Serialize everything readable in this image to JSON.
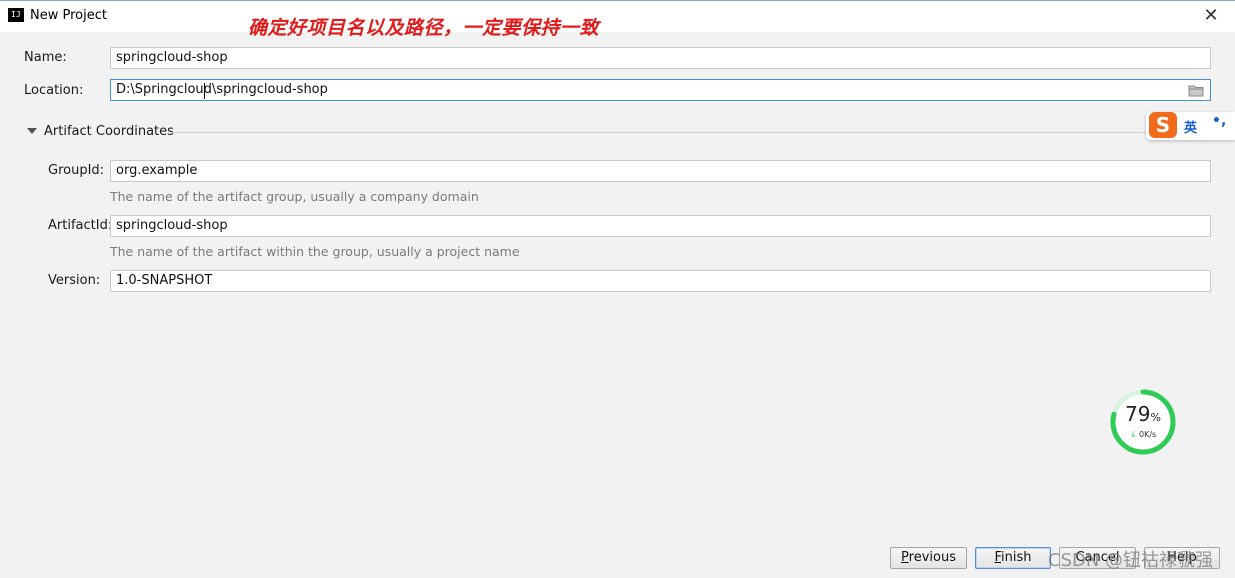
{
  "window": {
    "title": "New Project",
    "app_icon_text": "IJ",
    "close_glyph": "✕"
  },
  "annotation": "确定好项目名以及路径，一定要保持一致",
  "form": {
    "name_label": "Name:",
    "name_value": "springcloud-shop",
    "location_label": "Location:",
    "location_value": "D:\\Springcloud\\springcloud-shop"
  },
  "artifact": {
    "section_title": "Artifact Coordinates",
    "groupid_label": "GroupId:",
    "groupid_value": "org.example",
    "groupid_hint": "The name of the artifact group, usually a company domain",
    "artifactid_label": "ArtifactId:",
    "artifactid_value": "springcloud-shop",
    "artifactid_hint": "The name of the artifact within the group, usually a project name",
    "version_label": "Version:",
    "version_value": "1.0-SNAPSHOT"
  },
  "ime": {
    "logo": "S",
    "lang": "英",
    "punct": "•,"
  },
  "network": {
    "percent": "79",
    "percent_unit": "%",
    "speed": "0K/s",
    "usage_fraction": 0.79,
    "ring_color": "#2fcc55"
  },
  "buttons": {
    "previous_mnemonic": "P",
    "previous_rest": "revious",
    "finish_mnemonic": "F",
    "finish_rest": "inish",
    "cancel": "Cancel",
    "help": "Help"
  },
  "watermark": "CSDN @钮祜禄虢强",
  "colors": {
    "focus_border": "#4a8fd9",
    "annotation": "#e21a1a",
    "ime_brand": "#f26b1d"
  }
}
